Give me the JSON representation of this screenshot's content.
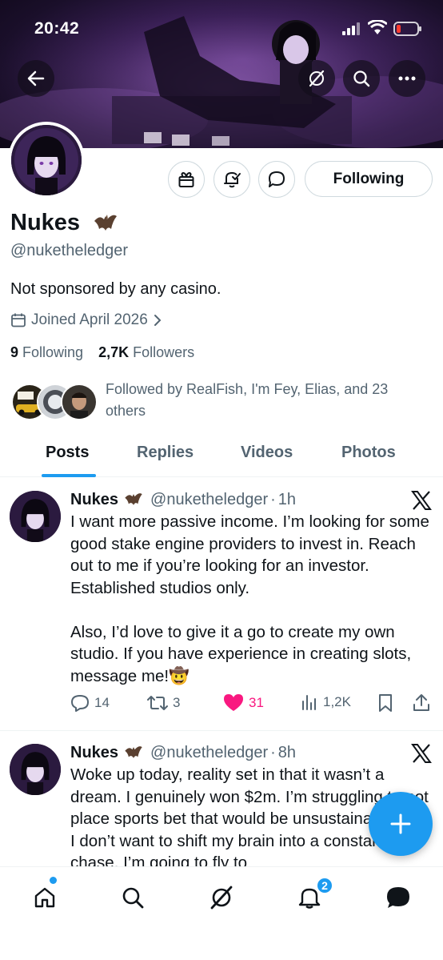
{
  "status_bar": {
    "time": "20:42"
  },
  "profile": {
    "name": "Nukes",
    "name_emoji": "bat",
    "handle": "@nuketheledger",
    "bio": "Not sponsored by any casino.",
    "joined": "Joined April 2026",
    "following_count": "9",
    "following_label": "Following",
    "followers_count": "2,7K",
    "followers_label": "Followers",
    "followed_by": "Followed by RealFish, I'm Fey, Elias, and 23 others",
    "follow_button": "Following"
  },
  "tabs": [
    {
      "label": "Posts",
      "active": true
    },
    {
      "label": "Replies",
      "active": false
    },
    {
      "label": "Videos",
      "active": false
    },
    {
      "label": "Photos",
      "active": false
    }
  ],
  "posts": [
    {
      "name": "Nukes",
      "handle": "@nuketheledger",
      "time": "1h",
      "text": "I want more passive income. I’m looking for some good stake engine providers to invest in. Reach out to me if you’re looking for an investor. Established studios only.\n\nAlso, I’d love to give it a go to create my own studio. If you have experience in creating slots, message me!🤠",
      "replies": "14",
      "reposts": "3",
      "likes": "31",
      "views": "1,2K"
    },
    {
      "name": "Nukes",
      "handle": "@nuketheledger",
      "time": "8h",
      "text": "Woke up today, reality set in that it wasn’t a dream. I genuinely won $2m. I’m struggling to not place sports bet that would be unsustainable, and I don’t want to shift my brain into a constant chase. I’m going to fly to"
    }
  ],
  "nav": {
    "notification_count": "2"
  },
  "colors": {
    "accent": "#1d9bf0",
    "like": "#f91880",
    "text": "#0f1419",
    "secondary": "#536471"
  },
  "icons": [
    "back-arrow-icon",
    "grok-icon",
    "search-icon",
    "more-icon",
    "gift-icon",
    "bell-icon",
    "message-icon",
    "calendar-icon",
    "chevron-right-icon",
    "x-logo-icon",
    "reply-icon",
    "repost-icon",
    "heart-icon",
    "views-icon",
    "bookmark-icon",
    "share-icon",
    "plus-icon",
    "home-icon"
  ]
}
